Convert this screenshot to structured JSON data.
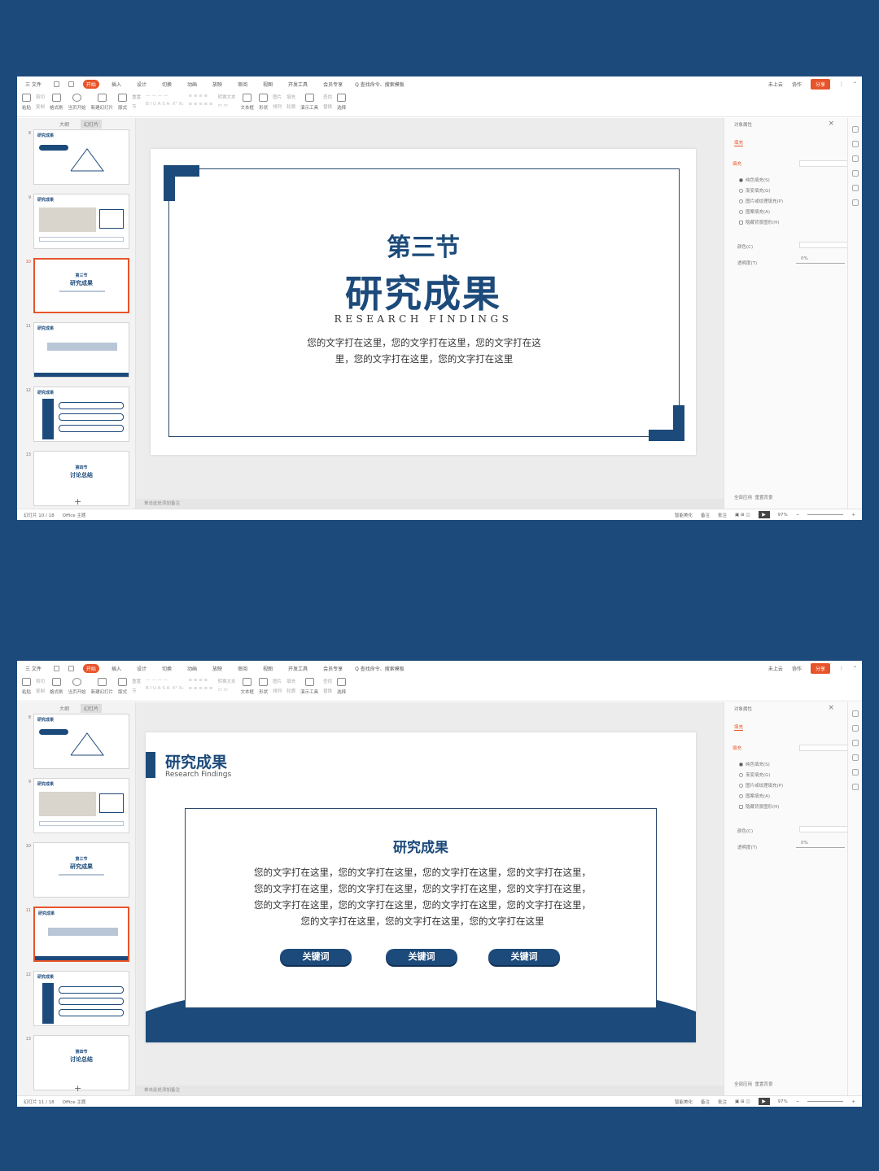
{
  "menu": {
    "tabs": [
      "三 文件",
      "开始",
      "插入",
      "设计",
      "切换",
      "动画",
      "放映",
      "审阅",
      "视图",
      "开发工具",
      "会员专享"
    ],
    "active_tab": "开始",
    "search": "Q 查找命令、搜索模板",
    "not_uploaded": "未上云",
    "collab": "协作",
    "share": "分享"
  },
  "toolbar": {
    "paste": "粘贴",
    "cut": "剪切",
    "copy": "复制",
    "format_painter": "格式刷",
    "play_from_current": "当页开始",
    "new_slide": "新建幻灯片",
    "layout": "版式",
    "section": "节",
    "reset": "重置",
    "convert_text": "转换文本",
    "textbox": "文本框",
    "shape": "形状",
    "arrange": "排列",
    "picture": "图片",
    "fill": "填充",
    "outline": "轮廓",
    "present_tools": "演示工具",
    "find": "查找",
    "replace": "替换",
    "select": "选择"
  },
  "panel": {
    "outline_tab": "大纲",
    "slides_tab": "幻灯片"
  },
  "props": {
    "title": "对象属性",
    "fill_tab": "填充",
    "fill_head": "填充",
    "options": [
      "纯色填充(S)",
      "渐变填充(G)",
      "图片或纹理填充(P)",
      "图案填充(A)",
      "隐藏背景图形(H)"
    ],
    "color_label": "颜色(C)",
    "transparency_label": "透明度(T)",
    "transparency_value": "0%",
    "apply_all": "全部应用",
    "reset_bg": "重置背景"
  },
  "notes_hint": "单击此处添加备注",
  "thumbs": {
    "t8": {
      "num": "8",
      "title": "研究成果"
    },
    "t9": {
      "num": "9",
      "title": "研究成果"
    },
    "t10": {
      "num": "10",
      "sub": "第三节",
      "title": "研究成果"
    },
    "t11": {
      "num": "11",
      "title": "研究成果",
      "sub": "研究成果"
    },
    "t12": {
      "num": "12",
      "title": "研究成果"
    },
    "t13": {
      "num": "13",
      "sub": "第四节",
      "title": "讨论总结"
    }
  },
  "window1": {
    "slide_counter": "幻灯片 10 / 18",
    "theme": "Office 主题",
    "smart_beautify": "智能美化",
    "notes_btn": "备注",
    "comments_btn": "批注",
    "zoom": "97%"
  },
  "window2": {
    "slide_counter": "幻灯片 11 / 18",
    "theme": "Office 主题",
    "smart_beautify": "智能美化",
    "notes_btn": "备注",
    "comments_btn": "批注",
    "zoom": "97%"
  },
  "slide1": {
    "section": "第三节",
    "title": "研究成果",
    "en_title": "RESEARCH FINDINGS",
    "body_line1": "您的文字打在这里，您的文字打在这里，您的文字打在这",
    "body_line2": "里，您的文字打在这里，您的文字打在这里"
  },
  "slide2": {
    "title": "研究成果",
    "en_title": "Research Findings",
    "card_title": "研究成果",
    "body_lines": [
      "您的文字打在这里，您的文字打在这里，您的文字打在这里，您的文字打在这里，",
      "您的文字打在这里，您的文字打在这里，您的文字打在这里，您的文字打在这里，",
      "您的文字打在这里，您的文字打在这里，您的文字打在这里，您的文字打在这里，",
      "您的文字打在这里，您的文字打在这里，您的文字打在这里"
    ],
    "keywords": [
      "关键词",
      "关键词",
      "关键词"
    ]
  },
  "colors": {
    "background": "#1c4a7a",
    "accent": "#e8542a",
    "slide_blue": "#1c4a7a"
  }
}
